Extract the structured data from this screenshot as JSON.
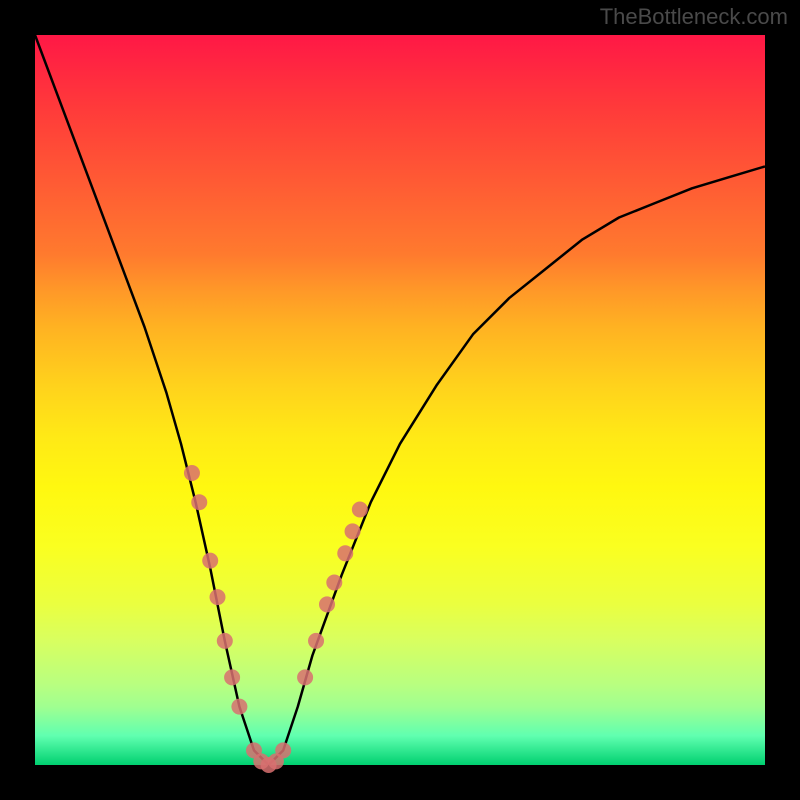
{
  "watermark": "TheBottleneck.com",
  "chart_data": {
    "type": "line",
    "title": "",
    "xlabel": "",
    "ylabel": "",
    "xlim": [
      0,
      100
    ],
    "ylim": [
      0,
      100
    ],
    "grid": false,
    "legend": false,
    "series": [
      {
        "name": "bottleneck-curve",
        "color": "#000000",
        "x": [
          0,
          3,
          6,
          9,
          12,
          15,
          18,
          20,
          22,
          24,
          26,
          28,
          30,
          32,
          34,
          36,
          38,
          42,
          46,
          50,
          55,
          60,
          65,
          70,
          75,
          80,
          85,
          90,
          95,
          100
        ],
        "y": [
          100,
          92,
          84,
          76,
          68,
          60,
          51,
          44,
          36,
          27,
          17,
          8,
          2,
          0,
          2,
          8,
          15,
          26,
          36,
          44,
          52,
          59,
          64,
          68,
          72,
          75,
          77,
          79,
          80.5,
          82
        ]
      }
    ],
    "markers": {
      "name": "highlight-points",
      "color": "#d87070",
      "radius_px": 8,
      "x": [
        21.5,
        22.5,
        24.0,
        25.0,
        26.0,
        27.0,
        28.0,
        30.0,
        31.0,
        32.0,
        33.0,
        34.0,
        37.0,
        38.5,
        40.0,
        41.0,
        42.5,
        43.5,
        44.5
      ],
      "y": [
        40.0,
        36.0,
        28.0,
        23.0,
        17.0,
        12.0,
        8.0,
        2.0,
        0.5,
        0.0,
        0.5,
        2.0,
        12.0,
        17.0,
        22.0,
        25.0,
        29.0,
        32.0,
        35.0
      ]
    }
  }
}
